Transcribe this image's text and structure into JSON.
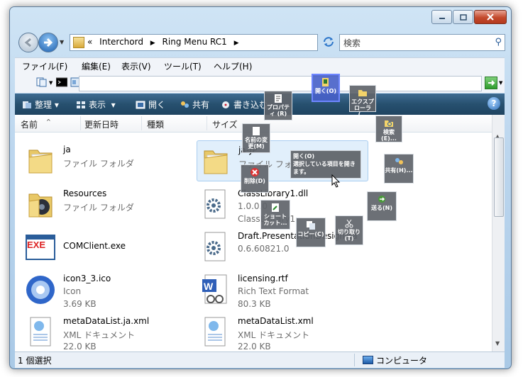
{
  "address": {
    "breadcrumb_prefix": "«",
    "crumbs": [
      "Interchord",
      "Ring Menu RC1"
    ]
  },
  "search": {
    "placeholder": "検索"
  },
  "menu": [
    "ファイル(F)",
    "編集(E)",
    "表示(V)",
    "ツール(T)",
    "ヘルプ(H)"
  ],
  "toolbar": {
    "organize": "整理",
    "views": "表示",
    "open": "開く",
    "share": "共有",
    "burn": "書き込む"
  },
  "columns": {
    "name": "名前",
    "modified": "更新日時",
    "type": "種類",
    "size": "サイズ"
  },
  "files": [
    {
      "name": "ja",
      "line2": "ファイル フォルダ",
      "line3": "",
      "icon": "folder-icon"
    },
    {
      "name": "ja-JP",
      "line2": "ファイル フォルダ",
      "line3": "",
      "icon": "folder-icon"
    },
    {
      "name": "Resources",
      "line2": "ファイル フォルダ",
      "line3": "",
      "icon": "folder-icon"
    },
    {
      "name": "ClassLibrary1.dll",
      "line2": "1.0.0.0",
      "line3": "ClassLibrary1",
      "icon": "dll-gear-icon"
    },
    {
      "name": "COMClient.exe",
      "line2": "",
      "line3": "",
      "icon": "exe-icon"
    },
    {
      "name": "Draft.PresentationDesignMa",
      "line2": "0.6.60821.0",
      "line3": "",
      "icon": "dll-gear-icon"
    },
    {
      "name": "icon3_3.ico",
      "line2": "Icon",
      "line3": "3.69 KB",
      "icon": "ico-icon"
    },
    {
      "name": "licensing.rtf",
      "line2": "Rich Text Format",
      "line3": "80.3 KB",
      "icon": "word-doc-icon"
    },
    {
      "name": "metaDataList.ja.xml",
      "line2": "XML ドキュメント",
      "line3": "22.0 KB",
      "icon": "xml-icon"
    },
    {
      "name": "metaDataList.xml",
      "line2": "XML ドキュメント",
      "line3": "22.0 KB",
      "icon": "xml-icon"
    }
  ],
  "ring_menu": {
    "open": "開く(O)",
    "explorer": "エクスプ ローラ(...",
    "properties": "プロパティ (R)",
    "rename": "名前の変 更(M)",
    "search": "検索(E)...",
    "delete": "削除(D)",
    "share": "共有(H)...",
    "send_to": "送る(N)",
    "shortcut": "ショート カット...",
    "copy": "コピー(C)",
    "cut": "切り取り (T)"
  },
  "tooltip": {
    "line1": "開く(O)",
    "line2": "選択している項目を開きます。"
  },
  "status": {
    "left": "1 個選択",
    "right": "コンピュータ"
  }
}
